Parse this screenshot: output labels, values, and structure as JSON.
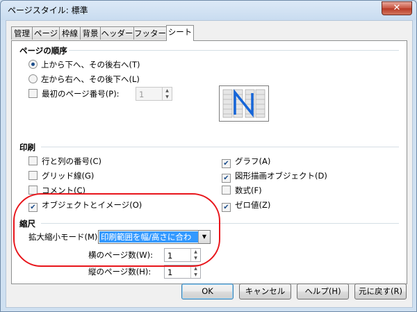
{
  "window": {
    "title": "ページスタイル: 標準",
    "close_label": "✕"
  },
  "tabs": [
    {
      "label": "管理",
      "active": false
    },
    {
      "label": "ページ",
      "active": false
    },
    {
      "label": "枠線",
      "active": false
    },
    {
      "label": "背景",
      "active": false
    },
    {
      "label": "ヘッダー",
      "active": false
    },
    {
      "label": "フッター",
      "active": false
    },
    {
      "label": "シート",
      "active": true
    }
  ],
  "page_order": {
    "title": "ページの順序",
    "option_top_down": "上から下へ、その後右へ(T)",
    "option_left_right": "左から右へ、その後下へ(L)",
    "first_page_number_label": "最初のページ番号(P):",
    "first_page_number_value": "1"
  },
  "print": {
    "title": "印刷",
    "items_left": [
      {
        "label": "行と列の番号(C)",
        "checked": false
      },
      {
        "label": "グリッド線(G)",
        "checked": false
      },
      {
        "label": "コメント(C)",
        "checked": false
      },
      {
        "label": "オブジェクトとイメージ(O)",
        "checked": true
      }
    ],
    "items_right": [
      {
        "label": "グラフ(A)",
        "checked": true
      },
      {
        "label": "図形描画オブジェクト(D)",
        "checked": true
      },
      {
        "label": "数式(F)",
        "checked": false
      },
      {
        "label": "ゼロ値(Z)",
        "checked": true
      }
    ]
  },
  "scale": {
    "title": "縮尺",
    "mode_label": "拡大縮小モード(M)",
    "mode_value": "印刷範囲を幅/高さに合わせる",
    "width_pages_label": "横のページ数(W):",
    "width_pages_value": "1",
    "height_pages_label": "縦のページ数(H):",
    "height_pages_value": "1"
  },
  "buttons": {
    "ok": "OK",
    "cancel": "キャンセル",
    "help": "ヘルプ(H)",
    "reset": "元に戻す(R)"
  },
  "annotation_color": "#e8151b"
}
